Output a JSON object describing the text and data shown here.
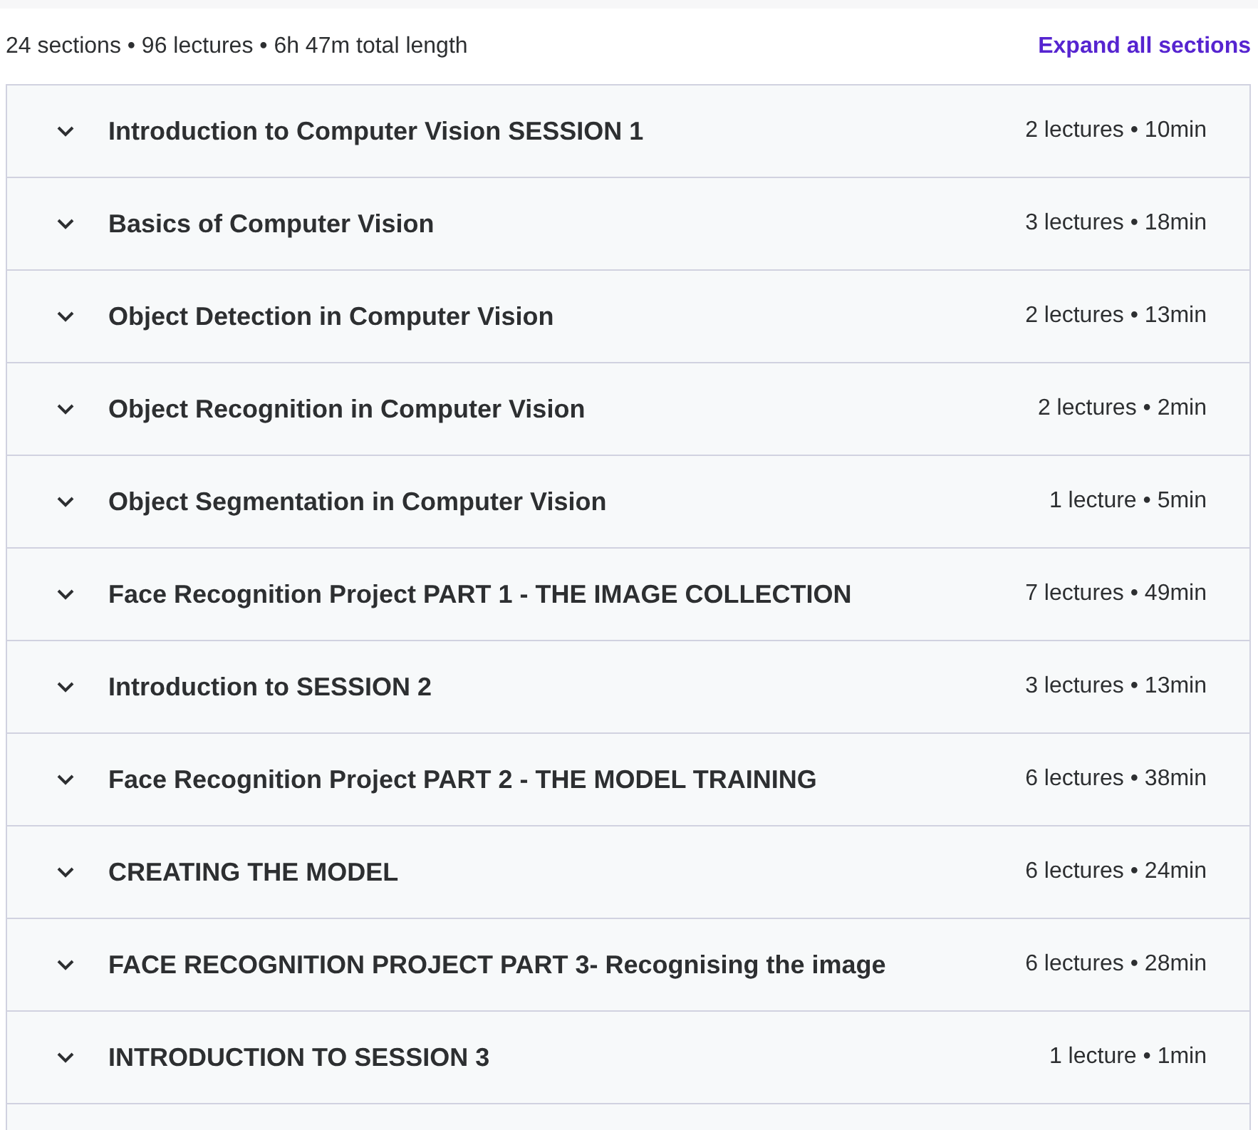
{
  "summary": "24 sections • 96 lectures • 6h 47m total length",
  "expand_all": "Expand all sections",
  "sections": [
    {
      "title": "Introduction to Computer Vision SESSION 1",
      "meta": "2 lectures • 10min",
      "expanded": false
    },
    {
      "title": "Basics of Computer Vision",
      "meta": "3 lectures • 18min",
      "expanded": false
    },
    {
      "title": "Object Detection in Computer Vision",
      "meta": "2 lectures • 13min",
      "expanded": false
    },
    {
      "title": "Object Recognition in Computer Vision",
      "meta": "2 lectures • 2min",
      "expanded": false
    },
    {
      "title": "Object Segmentation in Computer Vision",
      "meta": "1 lecture • 5min",
      "expanded": false
    },
    {
      "title": "Face Recognition Project PART 1 - THE IMAGE COLLECTION",
      "meta": "7 lectures • 49min",
      "expanded": false
    },
    {
      "title": "Introduction to SESSION 2",
      "meta": "3 lectures • 13min",
      "expanded": false
    },
    {
      "title": "Face Recognition Project PART 2 - THE MODEL TRAINING",
      "meta": "6 lectures • 38min",
      "expanded": false
    },
    {
      "title": "CREATING THE MODEL",
      "meta": "6 lectures • 24min",
      "expanded": false
    },
    {
      "title": "FACE RECOGNITION PROJECT PART 3- Recognising the image",
      "meta": "6 lectures • 28min",
      "expanded": false
    },
    {
      "title": "INTRODUCTION TO SESSION 3",
      "meta": "1 lecture • 1min",
      "expanded": false
    }
  ]
}
